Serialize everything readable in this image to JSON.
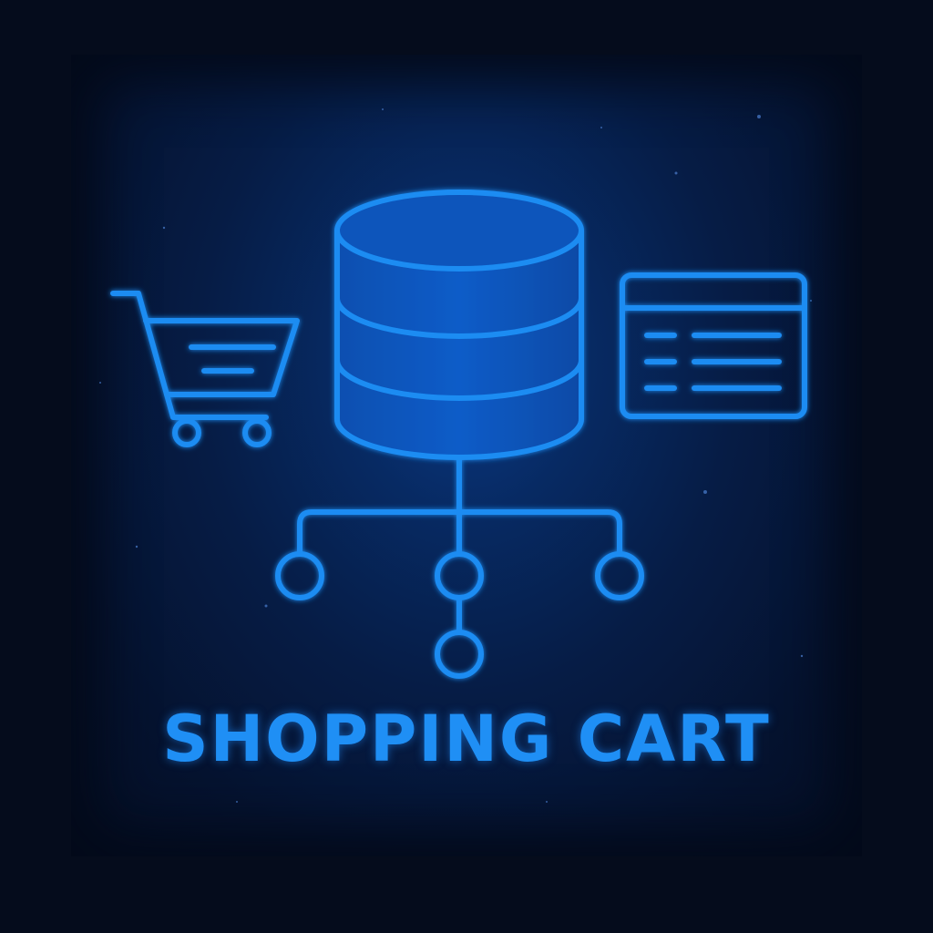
{
  "title": "SHOPPING CART",
  "icons": {
    "left": "shopping-cart-icon",
    "center": "database-icon",
    "right": "browser-list-icon",
    "bottom": "network-tree-icon"
  },
  "colors": {
    "background": "#050c1c",
    "panel_glow": "#0b3a86",
    "accent": "#1f8ff5",
    "stroke": "#1b8cf2"
  }
}
